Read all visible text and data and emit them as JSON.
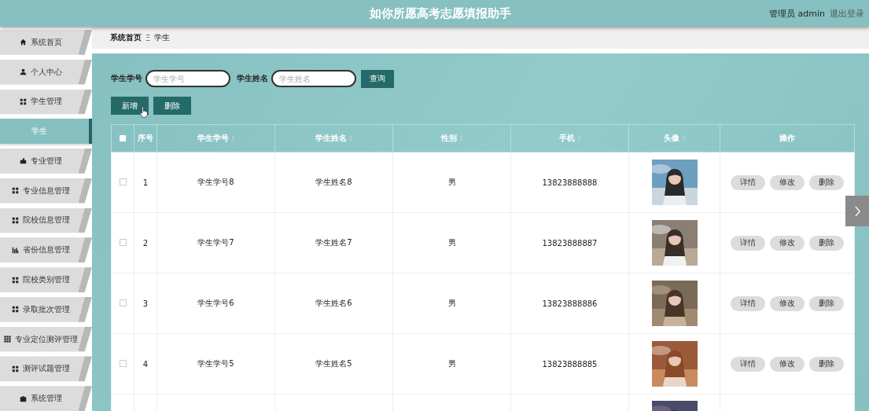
{
  "header": {
    "title": "如你所愿高考志愿填报助手",
    "user": "管理员 admin",
    "logout": "退出登录"
  },
  "sidebar": {
    "items": [
      {
        "label": "系统首页",
        "kind": "home",
        "selected": false
      },
      {
        "label": "个人中心",
        "kind": "user",
        "selected": false
      },
      {
        "label": "学生管理",
        "kind": "grid",
        "selected": false
      },
      {
        "label": "学生",
        "kind": "sub",
        "selected": true
      },
      {
        "label": "专业管理",
        "kind": "building",
        "selected": false
      },
      {
        "label": "专业信息管理",
        "kind": "grid",
        "selected": false
      },
      {
        "label": "院校信息管理",
        "kind": "grid",
        "selected": false
      },
      {
        "label": "省份信息管理",
        "kind": "chart",
        "selected": false
      },
      {
        "label": "院校类别管理",
        "kind": "grid",
        "selected": false
      },
      {
        "label": "录取批次管理",
        "kind": "grid",
        "selected": false
      },
      {
        "label": "专业定位测评管理",
        "kind": "grid9",
        "selected": false
      },
      {
        "label": "测评试题管理",
        "kind": "grid",
        "selected": false
      },
      {
        "label": "系统管理",
        "kind": "briefcase",
        "selected": false
      }
    ]
  },
  "breadcrumb": {
    "home": "系统首页",
    "separator": "Ξ",
    "current": "学生"
  },
  "search": {
    "fields": [
      {
        "label": "学生学号",
        "placeholder": "学生学号"
      },
      {
        "label": "学生姓名",
        "placeholder": "学生姓名"
      }
    ],
    "button": "查询"
  },
  "actions": [
    "新增",
    "删除"
  ],
  "table": {
    "select_all_checked": false,
    "columns": [
      {
        "label": "序号",
        "sortable": false
      },
      {
        "label": "学生学号",
        "sortable": true
      },
      {
        "label": "学生姓名",
        "sortable": true
      },
      {
        "label": "性别",
        "sortable": true
      },
      {
        "label": "手机",
        "sortable": true
      },
      {
        "label": "头像",
        "sortable": true
      },
      {
        "label": "操作",
        "sortable": false
      }
    ],
    "rows": [
      {
        "checked": false,
        "index": "1",
        "student_no": "学生学号8",
        "name": "学生姓名8",
        "gender": "男",
        "phone": "13823888888",
        "avatar": {
          "kind": "picture"
        },
        "actions": [
          "详情",
          "修改",
          "删除"
        ]
      },
      {
        "checked": false,
        "index": "2",
        "student_no": "学生学号7",
        "name": "学生姓名7",
        "gender": "男",
        "phone": "13823888887",
        "avatar": {
          "kind": "picture"
        },
        "actions": [
          "详情",
          "修改",
          "删除"
        ]
      },
      {
        "checked": false,
        "index": "3",
        "student_no": "学生学号6",
        "name": "学生姓名6",
        "gender": "男",
        "phone": "13823888886",
        "avatar": {
          "kind": "picture"
        },
        "actions": [
          "详情",
          "修改",
          "删除"
        ]
      },
      {
        "checked": false,
        "index": "4",
        "student_no": "学生学号5",
        "name": "学生姓名5",
        "gender": "男",
        "phone": "13823888885",
        "avatar": {
          "kind": "picture"
        },
        "actions": [
          "详情",
          "修改",
          "删除"
        ]
      }
    ]
  }
}
